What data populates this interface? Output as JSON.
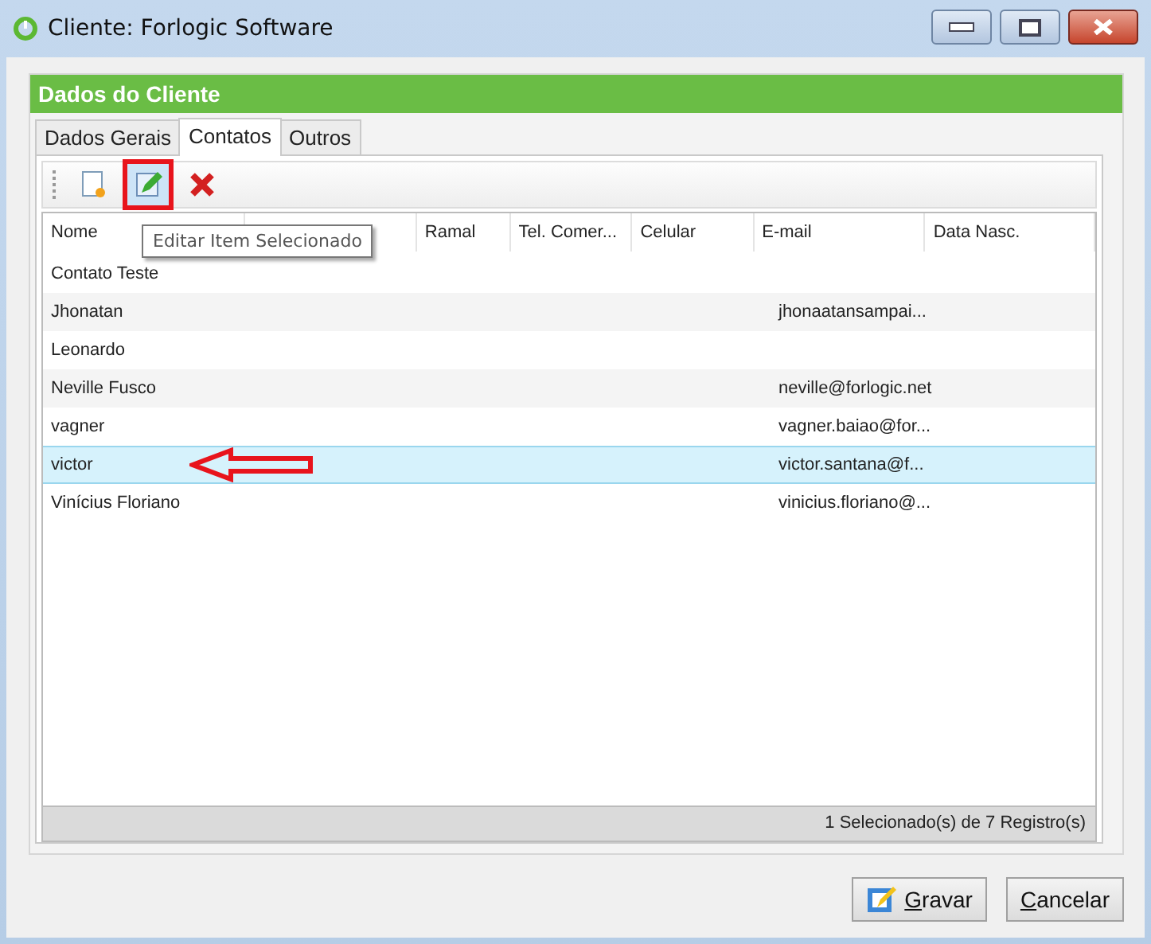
{
  "window": {
    "title": "Cliente: Forlogic Software"
  },
  "panel": {
    "title": "Dados do Cliente"
  },
  "tabs": [
    {
      "label": "Dados Gerais",
      "selected": false
    },
    {
      "label": "Contatos",
      "selected": true
    },
    {
      "label": "Outros",
      "selected": false
    }
  ],
  "toolbar": [
    {
      "kind": "new",
      "highlighted": false
    },
    {
      "kind": "edit",
      "highlighted": true
    },
    {
      "kind": "delete",
      "highlighted": false
    }
  ],
  "tooltip": "Editar Item Selecionado",
  "table": {
    "columns": [
      "Nome",
      "Ramal",
      "Tel. Comer...",
      "Celular",
      "E-mail",
      "Data Nasc."
    ],
    "rows": [
      {
        "nome": "Contato Teste",
        "selected": false,
        "arrow": false
      },
      {
        "nome": "Jhonatan",
        "email": "jhonaatansampai...",
        "selected": false,
        "arrow": false
      },
      {
        "nome": "Leonardo",
        "selected": false,
        "arrow": false
      },
      {
        "nome": "Neville Fusco",
        "email": "neville@forlogic.net",
        "selected": false,
        "arrow": false
      },
      {
        "nome": "vagner",
        "email": "vagner.baiao@for...",
        "selected": false,
        "arrow": false
      },
      {
        "nome": "victor",
        "email": "victor.santana@f...",
        "selected": true,
        "arrow": true
      },
      {
        "nome": "Vinícius Floriano",
        "email": "vinicius.floriano@...",
        "selected": false,
        "arrow": false
      }
    ]
  },
  "status_bar": "1 Selecionado(s) de 7 Registro(s)",
  "buttons": [
    {
      "label": "Gravar",
      "kind": "save"
    },
    {
      "label": "Cancelar",
      "kind": "cancel"
    }
  ]
}
